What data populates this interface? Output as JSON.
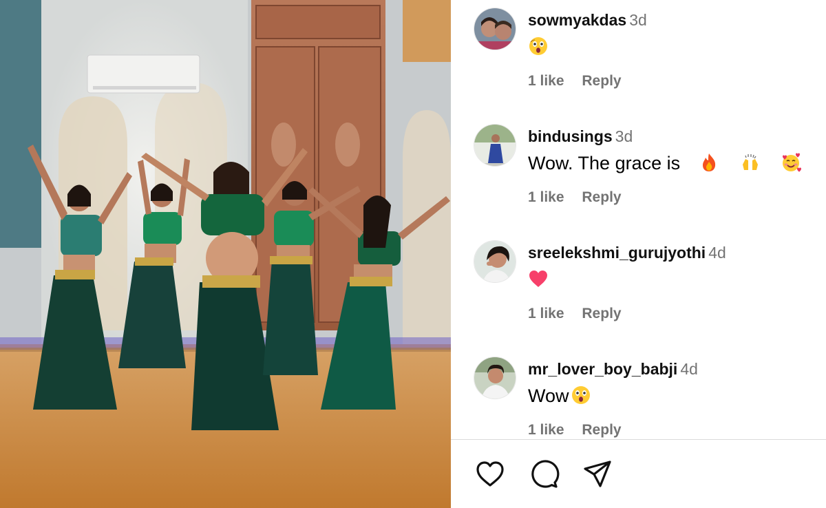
{
  "post": {
    "media_alt": "Five dancers in green tops and dark green skirts posing with raised arms in a dance studio"
  },
  "comments": [
    {
      "username": "sowmyakdas",
      "age": "3d",
      "text": "",
      "emojis": [
        "astonished-face"
      ],
      "likes": "1 like",
      "reply": "Reply"
    },
    {
      "username": "bindusings",
      "age": "3d",
      "text": "Wow. The grace is",
      "emojis": [
        "fire",
        "raising-hands",
        "smiling-face-with-hearts"
      ],
      "likes": "1 like",
      "reply": "Reply"
    },
    {
      "username": "sreelekshmi_gurujyothi",
      "age": "4d",
      "text": "",
      "emojis": [
        "red-heart"
      ],
      "likes": "1 like",
      "reply": "Reply"
    },
    {
      "username": "mr_lover_boy_babji",
      "age": "4d",
      "text": "Wow",
      "emojis": [
        "astonished-face"
      ],
      "likes": "1 like",
      "reply": "Reply"
    }
  ],
  "action_bar": {
    "icons": [
      "heart-icon",
      "comment-icon",
      "share-icon"
    ]
  },
  "colors": {
    "username": "#111111",
    "meta_gray": "#737373",
    "divider": "#dbdbdb",
    "outfit_green": "#0f5a3a"
  }
}
